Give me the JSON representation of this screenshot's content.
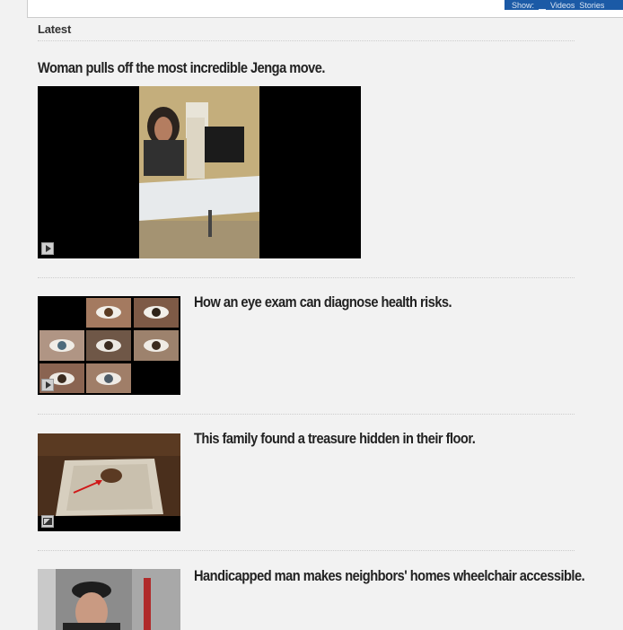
{
  "topbar": {
    "show_label": "Show:",
    "filter_videos": "Videos",
    "filter_stories": "Stories"
  },
  "section": {
    "label": "Latest"
  },
  "articles": [
    {
      "title": "Woman pulls off the most incredible Jenga move.",
      "media": "video",
      "badge_icon": "play-icon"
    },
    {
      "title": "How an eye exam can diagnose health risks.",
      "media": "video",
      "badge_icon": "play-icon"
    },
    {
      "title": "This family found a treasure hidden in their floor.",
      "media": "gallery",
      "badge_icon": "photo-icon"
    },
    {
      "title": "Handicapped man makes neighbors' homes wheelchair accessible.",
      "media": "video",
      "badge_icon": ""
    }
  ],
  "colors": {
    "background": "#f2f2f2",
    "accent": "#1b5aa6"
  }
}
